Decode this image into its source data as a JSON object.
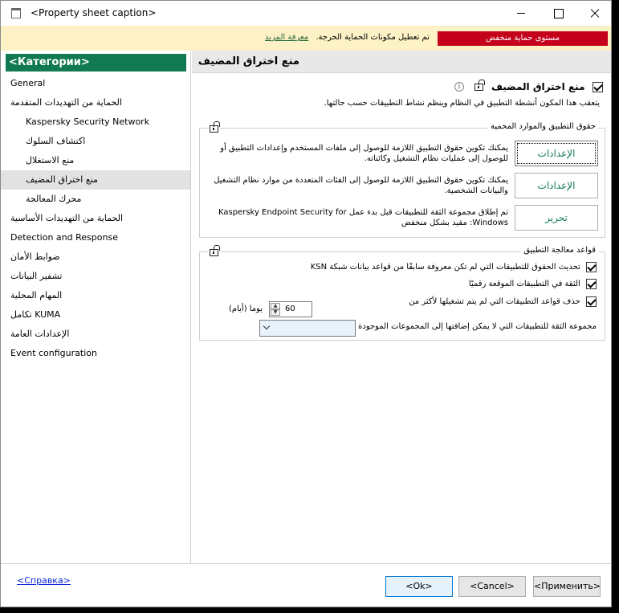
{
  "window": {
    "title": "<Property sheet caption>"
  },
  "warning": {
    "level": "مستوى حماية منخفض",
    "message": "تم تعطيل مكونات الحماية الحرجة.",
    "link": "معرفة المزيد"
  },
  "sidebar": {
    "header": "<Категории>",
    "items": [
      {
        "label": "General"
      },
      {
        "label": "الحماية من التهديدات المتقدمة"
      },
      {
        "label": "Kaspersky Security Network"
      },
      {
        "label": "اكتشاف السلوك"
      },
      {
        "label": "منع الاستغلال"
      },
      {
        "label": "منع اختراق المضيف"
      },
      {
        "label": "محرك المعالجة"
      },
      {
        "label": "الحماية من التهديدات الأساسية"
      },
      {
        "label": "Detection and Response"
      },
      {
        "label": "ضوابط الأمان"
      },
      {
        "label": "تشفير البيانات"
      },
      {
        "label": "المهام المحلية"
      },
      {
        "label": "تكامل KUMA"
      },
      {
        "label": "الإعدادات العامة"
      },
      {
        "label": "Event configuration"
      }
    ]
  },
  "section": {
    "title": "منع اختراق المضيف",
    "enable_label": "منع اختراق المضيف",
    "description": "يتعقب هذا المكون أنشطة التطبيق في النظام وينظم نشاط التطبيقات حسب حالتها."
  },
  "rights_group": {
    "title": "حقوق التطبيق والموارد المحمية",
    "rows": [
      {
        "button": "الإعدادات",
        "desc": "يمكنك تكوين حقوق التطبيق اللازمة للوصول إلى ملفات المستخدم وإعدادات التطبيق أو للوصول إلى عمليات نظام التشغيل وكائناته."
      },
      {
        "button": "الإعدادات",
        "desc": "يمكنك تكوين حقوق التطبيق اللازمة للوصول إلى الفئات المتعددة من موارد نظام التشغيل والبيانات الشخصية."
      },
      {
        "button": "تحرير",
        "desc": "تم إطلاق مجموعة الثقة للتطبيقات قبل بدء عمل Kaspersky Endpoint Security for Windows: مقيد بشكل منخفض"
      }
    ]
  },
  "rules_group": {
    "title": "قواعد معالجة التطبيق",
    "options": [
      {
        "label": "تحديث الحقوق للتطبيقات التي لم تكن معروفة سابقًا من قواعد بيانات شبكة KSN"
      },
      {
        "label": "الثقة في التطبيقات الموقعة رقميًا"
      },
      {
        "label": "حذف قواعد التطبيقات التي لم يتم تشغيلها لأكثر من"
      }
    ],
    "days_value": "60",
    "days_unit": "يوما (أيام)",
    "trust_group_label": "مجموعة الثقة للتطبيقات التي لا يمكن إضافتها إلى المجموعات الموجودة",
    "trust_group_value": ""
  },
  "footer": {
    "help": "<Справка>",
    "ok": "<Ok>",
    "cancel": "<Cancel>",
    "apply": "<Применить>"
  }
}
